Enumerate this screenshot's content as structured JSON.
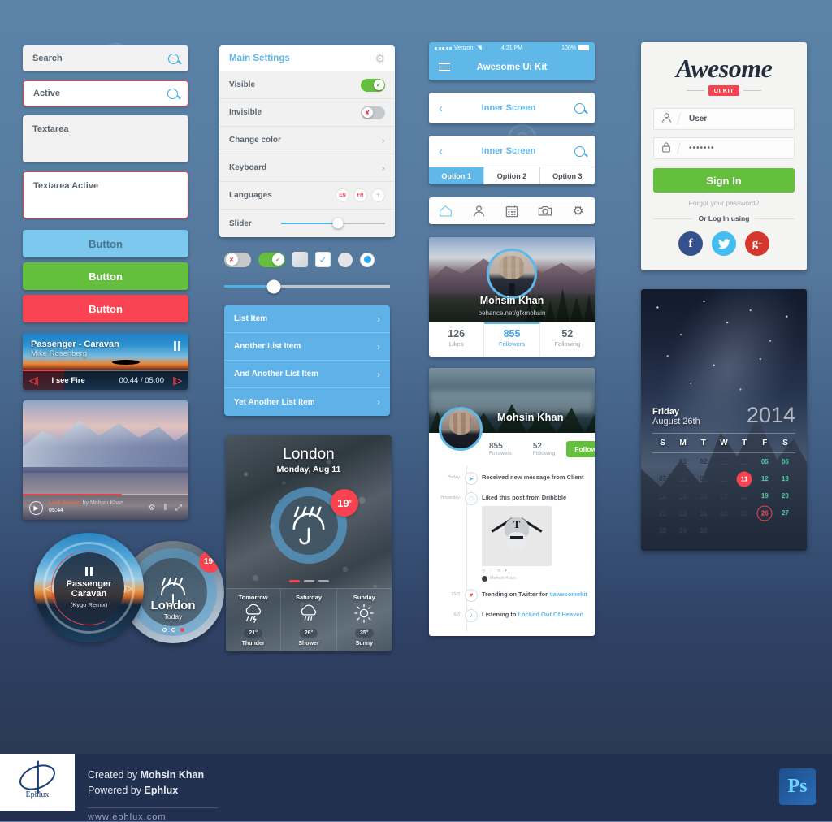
{
  "forms": {
    "search": {
      "value": "Search",
      "icon": "search-icon"
    },
    "search_active": {
      "value": "Active",
      "icon": "search-icon"
    },
    "textarea": {
      "value": "Textarea"
    },
    "textarea_active": {
      "value": "Textarea Active"
    },
    "buttons": [
      {
        "label": "Button",
        "style": "blue"
      },
      {
        "label": "Button",
        "style": "green"
      },
      {
        "label": "Button",
        "style": "red"
      }
    ]
  },
  "music_player": {
    "title": "Passenger - Caravan",
    "artist": "Mike Rosenberg",
    "song": "I see Fire",
    "time": "00:44 / 05:00",
    "progress_pct": 25
  },
  "video_player": {
    "title": "Last Sunset",
    "by": "by Mohsin Khan",
    "duration": "05:44",
    "progress_pct": 60
  },
  "circle_music": {
    "title_line1": "Passenger",
    "title_line2": "Caravan",
    "remix": "(Kygo Remix)"
  },
  "circle_weather": {
    "city": "London",
    "day": "Today",
    "temp": "19°"
  },
  "settings": {
    "title": "Main Settings",
    "gear_icon": "gear-icon",
    "rows": [
      {
        "label": "Visible",
        "control": "toggle-on"
      },
      {
        "label": "Invisible",
        "control": "toggle-off"
      },
      {
        "label": "Change color",
        "control": "chevron"
      },
      {
        "label": "Keyboard",
        "control": "chevron"
      },
      {
        "label": "Languages",
        "control": "languages"
      },
      {
        "label": "Slider",
        "control": "slider"
      }
    ],
    "languages": [
      "EN",
      "FR"
    ],
    "add_language": "+",
    "slider_pct": 55
  },
  "controls": {
    "toggle_off": "off",
    "toggle_on": "on",
    "checkbox_off": "unchecked",
    "checkbox_on": "checked",
    "radio_off": "unselected",
    "radio_on": "selected",
    "big_slider_pct": 30
  },
  "list": {
    "items": [
      {
        "label": "List Item"
      },
      {
        "label": "Another List Item"
      },
      {
        "label": "And Another List Item"
      },
      {
        "label": "Yet Another List Item"
      }
    ]
  },
  "weather_card": {
    "city": "London",
    "date": "Monday, Aug 11",
    "temp": "19",
    "degree": "°",
    "forecast": [
      {
        "day": "Tomorrow",
        "temp": "21°",
        "cond": "Thunder",
        "icon": "cloud-thunder-icon"
      },
      {
        "day": "Saturday",
        "temp": "26°",
        "cond": "Shower",
        "icon": "cloud-rain-icon"
      },
      {
        "day": "Sunday",
        "temp": "35°",
        "cond": "Sunny",
        "icon": "sun-icon"
      }
    ]
  },
  "phone": {
    "status": {
      "carrier": "Verizon",
      "time": "4:21 PM",
      "battery": "100%"
    },
    "nav_title": "Awesome Ui Kit",
    "inner_title": "Inner Screen",
    "segments": [
      "Option 1",
      "Option 2",
      "Option 3"
    ],
    "tabs": [
      "home-icon",
      "user-icon",
      "calendar-icon",
      "camera-icon",
      "gear-icon"
    ]
  },
  "profile": {
    "name": "Mohsin Khan",
    "url": "behance.net/gfxmohsin",
    "stats": [
      {
        "value": "126",
        "label": "Likes"
      },
      {
        "value": "855",
        "label": "Followers"
      },
      {
        "value": "52",
        "label": "Following"
      }
    ]
  },
  "feed": {
    "name": "Mohsin Khan",
    "followers_value": "855",
    "followers_label": "Followers",
    "following_value": "52",
    "following_label": "Following",
    "follow_label": "Follow",
    "items": [
      {
        "when": "Today",
        "icon": "send-icon",
        "text": "Received new message from Client"
      },
      {
        "when": "Yesterday",
        "icon": "like-icon",
        "text": "Liked this post from Dribbble",
        "has_image": true,
        "author": "Mohsin Khan"
      },
      {
        "when": "15/3",
        "icon": "trend-icon",
        "text": "Trending on Twitter for ",
        "link": "#awesomekit"
      },
      {
        "when": "6/3",
        "icon": "music-icon",
        "text": "Listening to ",
        "link": "Locked Out Of Heaven"
      }
    ]
  },
  "login": {
    "brand": "Awesome",
    "brand_badge": "UI KIT",
    "user_value": "User",
    "user_icon": "user-icon",
    "password_value": "•••••••",
    "password_icon": "lock-icon",
    "signin_label": "Sign In",
    "forgot_label": "Forgot your password?",
    "or_label": "Or Log In using",
    "socials": [
      {
        "name": "facebook-icon",
        "glyph": "f"
      },
      {
        "name": "twitter-icon",
        "glyph": "t"
      },
      {
        "name": "googleplus-icon",
        "glyph": "g+"
      }
    ]
  },
  "calendar": {
    "day_of_week": "Friday",
    "date": "August 26th",
    "year": "2014",
    "headers": [
      "S",
      "M",
      "T",
      "W",
      "T",
      "F",
      "S"
    ],
    "weeks": [
      [
        {
          "d": ""
        },
        {
          "d": "01"
        },
        {
          "d": "02"
        },
        {
          "d": "03"
        },
        {
          "d": "04"
        },
        {
          "d": "05",
          "weekend": true
        },
        {
          "d": "06",
          "weekend": true
        }
      ],
      [
        {
          "d": "07"
        },
        {
          "d": "08"
        },
        {
          "d": "09"
        },
        {
          "d": "10"
        },
        {
          "d": "11",
          "today": true
        },
        {
          "d": "12",
          "weekend": true
        },
        {
          "d": "13",
          "weekend": true
        }
      ],
      [
        {
          "d": "14"
        },
        {
          "d": "15"
        },
        {
          "d": "16"
        },
        {
          "d": "17"
        },
        {
          "d": "18"
        },
        {
          "d": "19",
          "weekend": true
        },
        {
          "d": "20",
          "weekend": true
        }
      ],
      [
        {
          "d": "21"
        },
        {
          "d": "22"
        },
        {
          "d": "23"
        },
        {
          "d": "24"
        },
        {
          "d": "25"
        },
        {
          "d": "26",
          "weekend": true,
          "selected": true
        },
        {
          "d": "27",
          "weekend": true
        }
      ],
      [
        {
          "d": "28"
        },
        {
          "d": "29"
        },
        {
          "d": "30"
        },
        {
          "d": ""
        },
        {
          "d": ""
        },
        {
          "d": ""
        },
        {
          "d": ""
        }
      ]
    ]
  },
  "footer": {
    "logo_name": "Ephlux",
    "created_prefix": "Created by ",
    "created_name": "Mohsin Khan",
    "powered_prefix": "Powered by ",
    "powered_name": "Ephlux",
    "website": "www.ephlux.com",
    "ps_badge": "Ps"
  },
  "colors": {
    "accent_blue": "#5fb8e8",
    "green": "#64bf3c",
    "red": "#f6434f",
    "bg_top": "#5b84a8",
    "bg_bottom": "#2b3a57"
  }
}
